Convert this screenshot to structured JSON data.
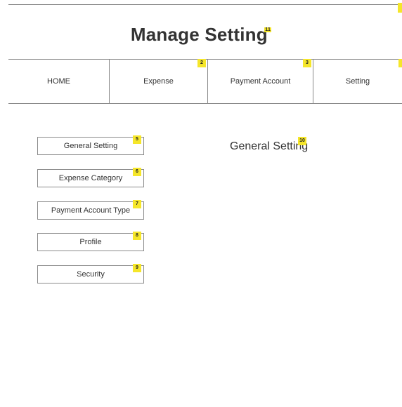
{
  "page": {
    "title": "Manage Setting"
  },
  "nav": {
    "items": [
      {
        "label": "HOME"
      },
      {
        "label": "Expense"
      },
      {
        "label": "Payment Account"
      },
      {
        "label": "Setting"
      }
    ]
  },
  "sidebar": {
    "items": [
      {
        "label": "General Setting"
      },
      {
        "label": "Expense Category"
      },
      {
        "label": "Payment Account Type"
      },
      {
        "label": "Profile"
      },
      {
        "label": "Security"
      }
    ]
  },
  "content": {
    "title": "General Setting"
  },
  "badges": {
    "title": "11",
    "nav_expense": "2",
    "nav_payment": "3",
    "side_general": "5",
    "side_expense_category": "6",
    "side_payment_type": "7",
    "side_profile": "8",
    "side_security": "9",
    "content_title": "10"
  },
  "colors": {
    "badge": "#f5e62a",
    "border": "#8a8a8a",
    "text": "#333333"
  }
}
